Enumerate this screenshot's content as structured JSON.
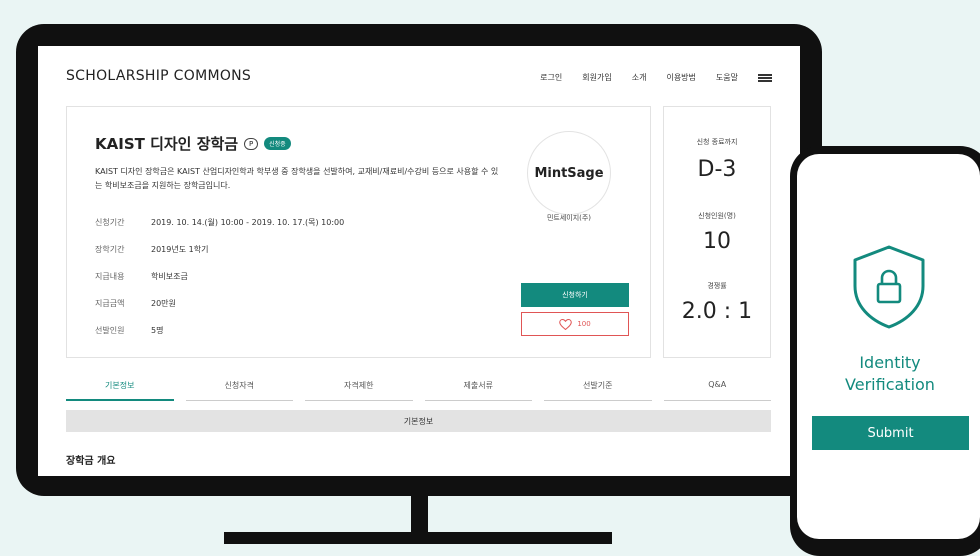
{
  "site": {
    "brand": "SCHOLARSHIP COMMONS"
  },
  "nav": {
    "items": [
      {
        "label": "로그인"
      },
      {
        "label": "회원가입"
      },
      {
        "label": "소개"
      },
      {
        "label": "이용방법"
      },
      {
        "label": "도움말"
      }
    ],
    "menu_icon": "hamburger-menu-icon"
  },
  "scholarship": {
    "title": "KAIST 디자인 장학금",
    "chat_icon_glyph": "P",
    "status_badge": "신청중",
    "description": "KAIST 디자인 장학금은 KAIST 산업디자인학과 학부생 중 장학생을 선발하여, 교재비/재료비/수강비 등으로 사용할 수 있는 학비보조금을 지원하는 장학금입니다.",
    "details": [
      {
        "key": "신청기간",
        "value": "2019. 10. 14.(월) 10:00 - 2019. 10. 17.(목) 10:00"
      },
      {
        "key": "장학기간",
        "value": "2019년도 1학기"
      },
      {
        "key": "지급내용",
        "value": "학비보조금"
      },
      {
        "key": "지급금액",
        "value": "20만원"
      },
      {
        "key": "선발인원",
        "value": "5명"
      }
    ],
    "sponsor_logo_text": "MintSage",
    "sponsor_name": "민트세이지(주)",
    "apply_label": "신청하기",
    "like_count": "100"
  },
  "stats": {
    "deadline_label": "신청 종료까지",
    "deadline_value": "D-3",
    "applicants_label": "신청인원(명)",
    "applicants_value": "10",
    "competition_label": "경쟁률",
    "competition_value": "2.0 : 1"
  },
  "tabs": [
    {
      "label": "기본정보",
      "active": true
    },
    {
      "label": "신청자격"
    },
    {
      "label": "자격제한"
    },
    {
      "label": "제출서류"
    },
    {
      "label": "선발기준"
    },
    {
      "label": "Q&A"
    }
  ],
  "section_bar": "기본정보",
  "section_title": "장학금 개요",
  "phone": {
    "verify_line1": "Identity",
    "verify_line2": "Verification",
    "submit_label": "Submit",
    "icon": "shield-lock-icon"
  },
  "colors": {
    "accent": "#138a7e",
    "heart": "#e05555",
    "background": "#eaf5f4",
    "frame": "#101010"
  }
}
